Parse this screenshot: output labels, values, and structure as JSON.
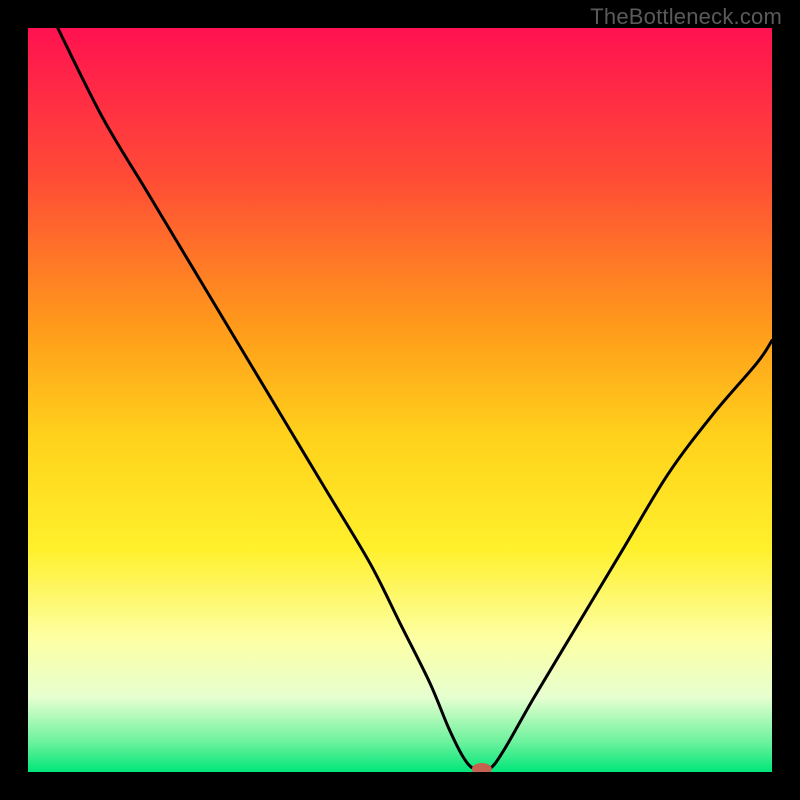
{
  "watermark": "TheBottleneck.com",
  "chart_data": {
    "type": "line",
    "title": "",
    "xlabel": "",
    "ylabel": "",
    "xlim": [
      0,
      100
    ],
    "ylim": [
      0,
      100
    ],
    "grid": false,
    "legend": false,
    "gradient_stops": [
      {
        "offset": 0.0,
        "color": "#ff1250"
      },
      {
        "offset": 0.2,
        "color": "#ff4b36"
      },
      {
        "offset": 0.4,
        "color": "#ff9a1b"
      },
      {
        "offset": 0.55,
        "color": "#ffd21b"
      },
      {
        "offset": 0.7,
        "color": "#fff02c"
      },
      {
        "offset": 0.82,
        "color": "#fdffa3"
      },
      {
        "offset": 0.9,
        "color": "#e6ffd0"
      },
      {
        "offset": 0.96,
        "color": "#6bf29c"
      },
      {
        "offset": 1.0,
        "color": "#00e67a"
      }
    ],
    "series": [
      {
        "name": "curve",
        "color": "#000000",
        "x": [
          4,
          10,
          16,
          22,
          28,
          34,
          40,
          46,
          50,
          54,
          56.5,
          58.5,
          60,
          62,
          64,
          68,
          74,
          80,
          86,
          92,
          98,
          100
        ],
        "y": [
          100,
          88,
          78,
          68,
          58,
          48,
          38,
          28,
          20,
          12,
          6,
          2,
          0.4,
          0.4,
          3,
          10,
          20,
          30,
          40,
          48,
          55,
          58
        ]
      }
    ],
    "marker": {
      "name": "optimum-marker",
      "x": 61,
      "y": 0.4,
      "color": "#c7614f",
      "rx": 10,
      "ry": 6
    }
  }
}
